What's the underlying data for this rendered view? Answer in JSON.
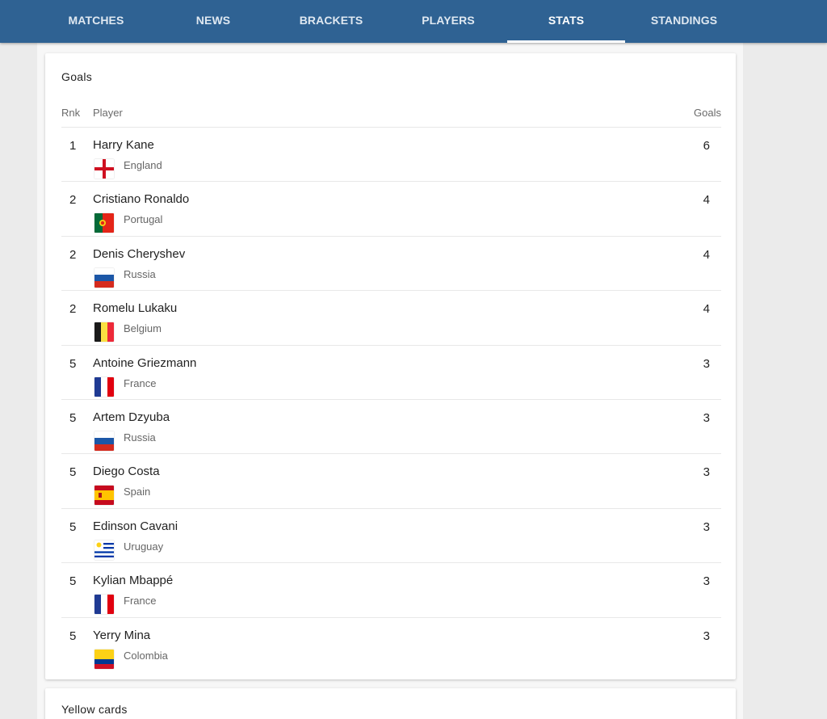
{
  "nav": {
    "tabs": [
      {
        "label": "MATCHES"
      },
      {
        "label": "NEWS"
      },
      {
        "label": "BRACKETS"
      },
      {
        "label": "PLAYERS"
      },
      {
        "label": "STATS",
        "active": true
      },
      {
        "label": "STANDINGS"
      }
    ]
  },
  "colors": {
    "nav_bg": "#2f6293",
    "page_bg": "#ebebeb",
    "card_bg": "#ffffff"
  },
  "goals_card": {
    "title": "Goals",
    "columns": {
      "rank": "Rnk",
      "player": "Player",
      "goals": "Goals"
    },
    "rows": [
      {
        "rank": "1",
        "player": "Harry Kane",
        "country": "England",
        "flag_icon": "england-flag-icon",
        "goals": "6"
      },
      {
        "rank": "2",
        "player": "Cristiano Ronaldo",
        "country": "Portugal",
        "flag_icon": "portugal-flag-icon",
        "goals": "4"
      },
      {
        "rank": "2",
        "player": "Denis Cheryshev",
        "country": "Russia",
        "flag_icon": "russia-flag-icon",
        "goals": "4"
      },
      {
        "rank": "2",
        "player": "Romelu Lukaku",
        "country": "Belgium",
        "flag_icon": "belgium-flag-icon",
        "goals": "4"
      },
      {
        "rank": "5",
        "player": "Antoine Griezmann",
        "country": "France",
        "flag_icon": "france-flag-icon",
        "goals": "3"
      },
      {
        "rank": "5",
        "player": "Artem Dzyuba",
        "country": "Russia",
        "flag_icon": "russia-flag-icon",
        "goals": "3"
      },
      {
        "rank": "5",
        "player": "Diego Costa",
        "country": "Spain",
        "flag_icon": "spain-flag-icon",
        "goals": "3"
      },
      {
        "rank": "5",
        "player": "Edinson Cavani",
        "country": "Uruguay",
        "flag_icon": "uruguay-flag-icon",
        "goals": "3"
      },
      {
        "rank": "5",
        "player": "Kylian Mbappé",
        "country": "France",
        "flag_icon": "france-flag-icon",
        "goals": "3"
      },
      {
        "rank": "5",
        "player": "Yerry Mina",
        "country": "Colombia",
        "flag_icon": "colombia-flag-icon",
        "goals": "3"
      }
    ]
  },
  "yellow_card": {
    "title": "Yellow cards"
  }
}
